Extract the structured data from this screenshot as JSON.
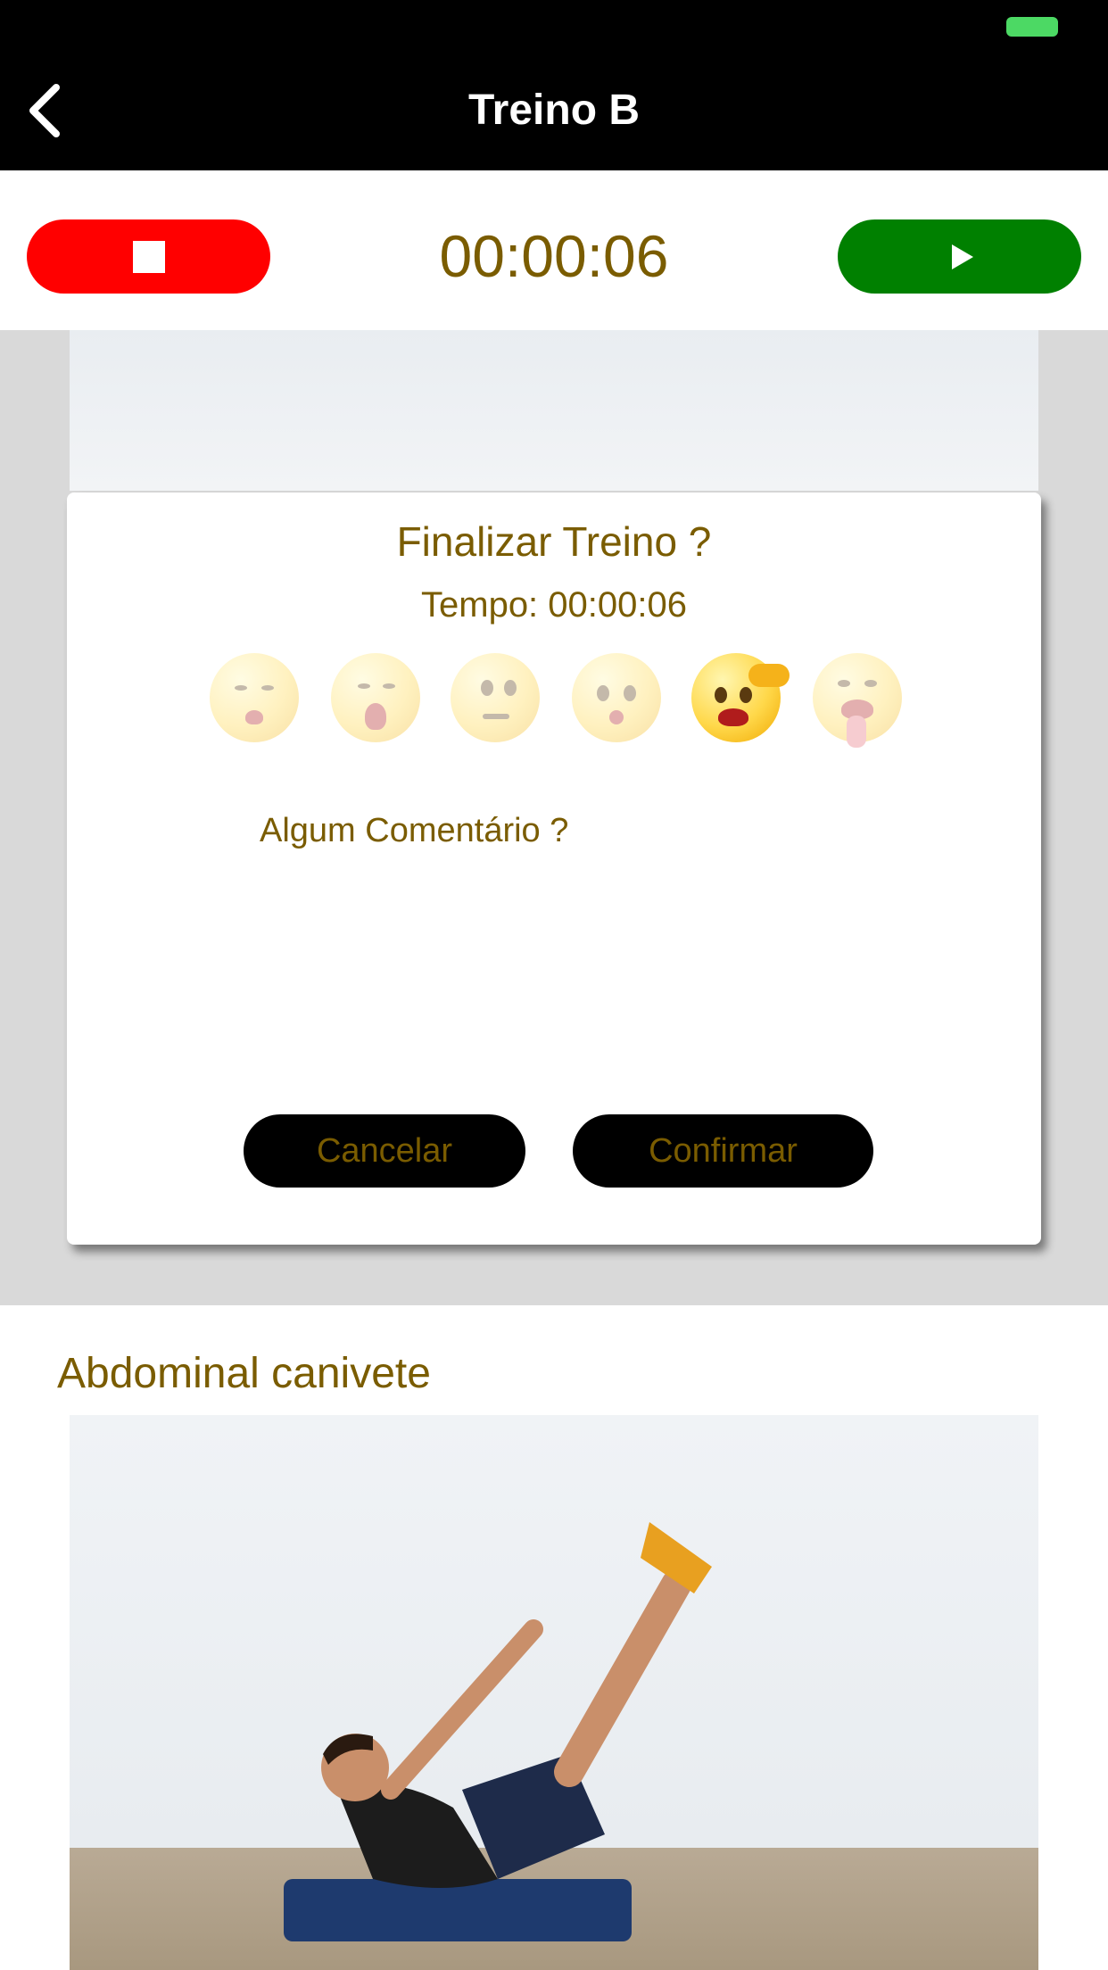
{
  "nav": {
    "title": "Treino B",
    "back_icon": "chevron-left-icon"
  },
  "timer": {
    "value": "00:00:06",
    "stop_icon": "stop-icon",
    "play_icon": "play-icon",
    "stop_color": "#ff0000",
    "play_color": "#008000"
  },
  "dialog": {
    "title": "Finalizar Treino ?",
    "time_label": "Tempo: 00:00:06",
    "emojis": [
      {
        "name": "sleepy-face-icon",
        "selected": false
      },
      {
        "name": "yawning-face-icon",
        "selected": false
      },
      {
        "name": "confused-face-icon",
        "selected": false
      },
      {
        "name": "surprised-face-icon",
        "selected": false
      },
      {
        "name": "exhausted-face-icon",
        "selected": true
      },
      {
        "name": "tongue-out-face-icon",
        "selected": false
      }
    ],
    "comment_prompt": "Algum Comentário ?",
    "comment_value": "",
    "cancel_label": "Cancelar",
    "confirm_label": "Confirmar"
  },
  "exercise": {
    "title": "Abdominal canivete"
  },
  "colors": {
    "accent_text": "#7a5c00",
    "status_battery": "#4cd964"
  }
}
